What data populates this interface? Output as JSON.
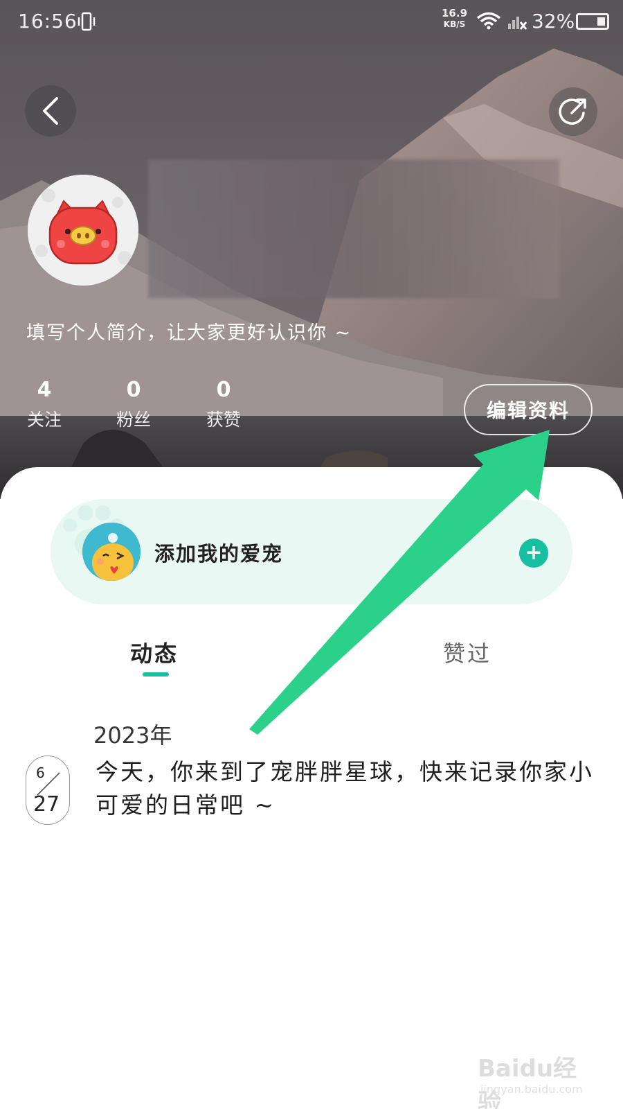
{
  "status_bar": {
    "time": "16:56",
    "net_speed_value": "16.9",
    "net_speed_unit": "KB/S",
    "battery": "32%"
  },
  "header": {
    "back_icon": "chevron-left-icon",
    "share_icon": "share-icon"
  },
  "profile": {
    "bio": "填写个人简介，让大家更好认识你 ~",
    "stats": [
      {
        "count": "4",
        "label": "关注"
      },
      {
        "count": "0",
        "label": "粉丝"
      },
      {
        "count": "0",
        "label": "获赞"
      }
    ],
    "edit_label": "编辑资料"
  },
  "pet_banner": {
    "label": "添加我的爱宠",
    "add_icon": "+"
  },
  "tabs": [
    {
      "label": "动态",
      "active": true
    },
    {
      "label": "赞过",
      "active": false
    }
  ],
  "timeline": {
    "year": "2023年",
    "month": "6",
    "day": "27",
    "text": "今天，你来到了宠胖胖星球，快来记录你家小可爱的日常吧 ~"
  },
  "watermark": {
    "text": "Baidu经验",
    "sub": "jingyan.baidu.com"
  },
  "colors": {
    "accent": "#17bfa0",
    "arrow": "#2bd18a",
    "banner_bg": "#e9f8f3"
  }
}
